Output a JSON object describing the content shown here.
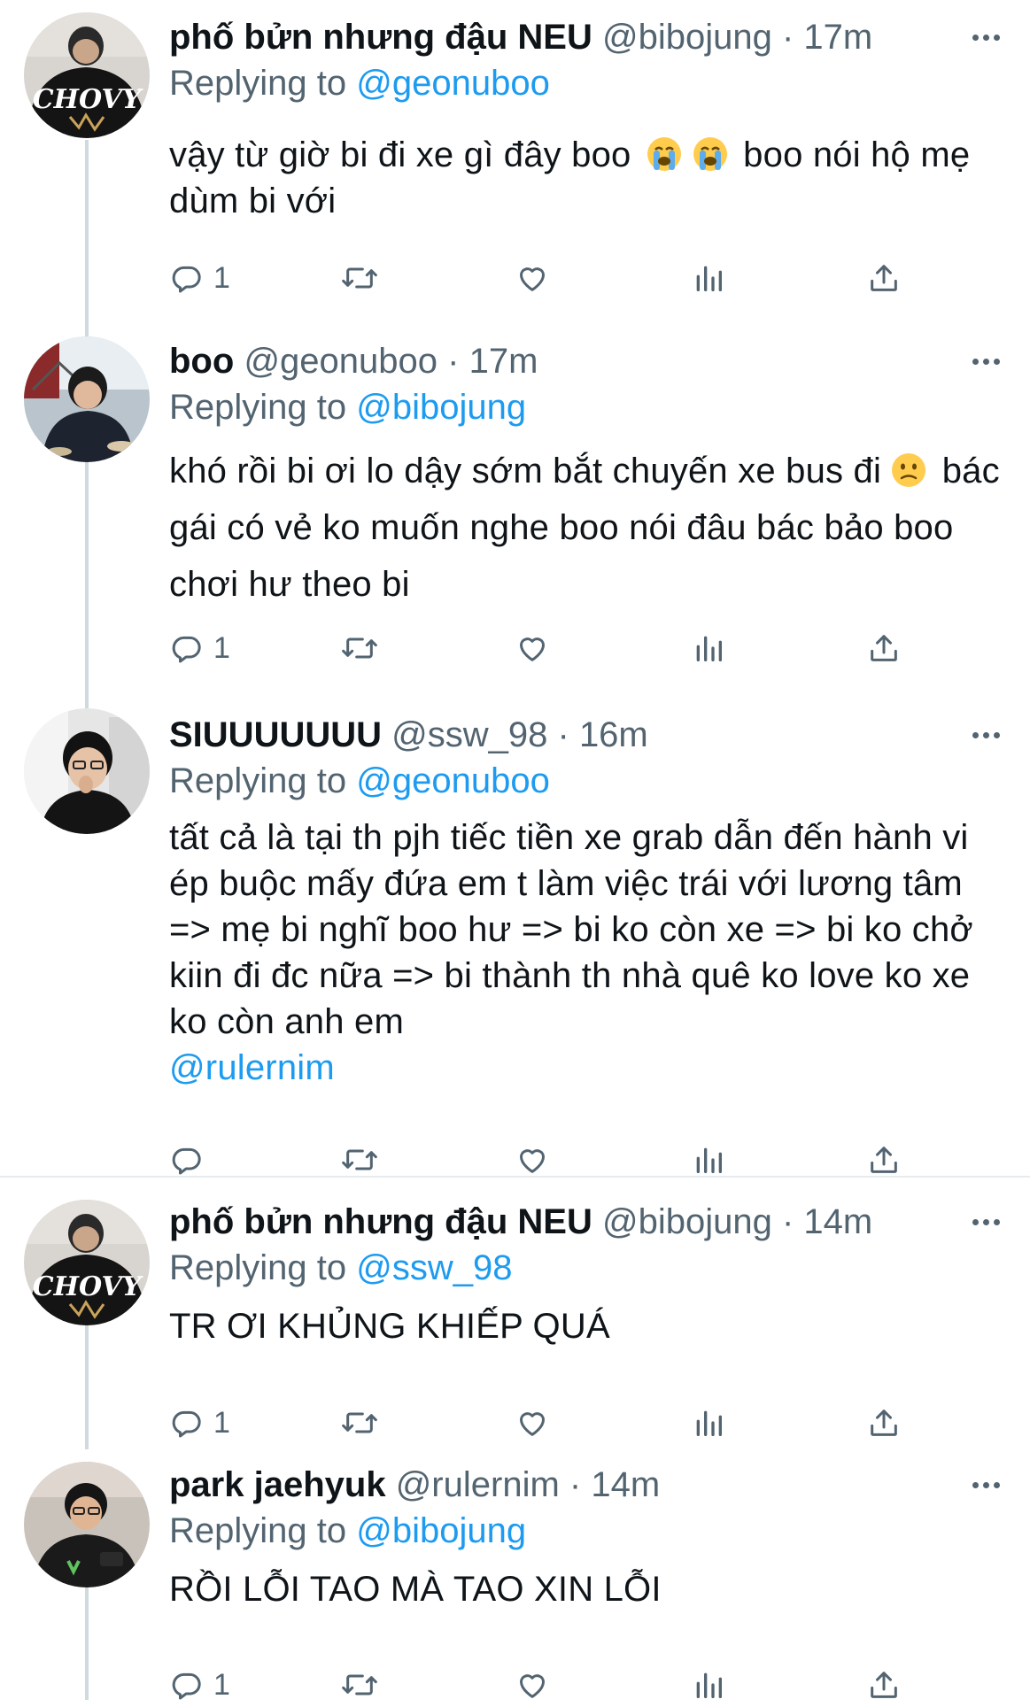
{
  "colors": {
    "accent": "#1d9bf0",
    "secondary_text": "#536471",
    "primary_text": "#0f1419",
    "thread_line": "#cfd9de"
  },
  "tweets": [
    {
      "name": "phố bửn nhưng đậu NEU",
      "handle": "@bibojung",
      "dot": "·",
      "time": "17m",
      "replying_label": "Replying to",
      "replying_to": "@geonuboo",
      "text_1": "vậy từ giờ bi đi xe gì đây boo",
      "emoji_1": "loudly-crying-face",
      "emoji_2": "loudly-crying-face",
      "text_2": "boo nói hộ mẹ dùm bi với",
      "reply_count": "1",
      "avatar_text": "CHOVY"
    },
    {
      "name": "boo",
      "handle": "@geonuboo",
      "dot": "·",
      "time": "17m",
      "replying_label": "Replying to",
      "replying_to": "@bibojung",
      "text_1": "khó rồi bi ơi lo dậy sớm bắt chuyến xe bus đi",
      "emoji_1": "confused-face",
      "text_2": "bác gái có vẻ ko muốn nghe boo nói đâu bác bảo boo chơi hư theo bi",
      "reply_count": "1"
    },
    {
      "name": "SIUUUUUUU",
      "handle": "@ssw_98",
      "dot": "·",
      "time": "16m",
      "replying_label": "Replying to",
      "replying_to": "@geonuboo",
      "text_1": "tất cả là tại th pjh tiếc tiền xe grab dẫn đến hành vi ép buộc mấy đứa em t làm việc trái với lương tâm => mẹ bi nghĩ boo hư => bi ko còn xe => bi ko chở kiin đi đc nữa => bi thành th nhà quê ko love ko xe ko còn anh em",
      "mention_in_text": "@rulernim",
      "reply_count": ""
    },
    {
      "name": "phố bửn nhưng đậu NEU",
      "handle": "@bibojung",
      "dot": "·",
      "time": "14m",
      "replying_label": "Replying to",
      "replying_to": "@ssw_98",
      "text_1": "TR ƠI KHỦNG KHIẾP QUÁ",
      "reply_count": "1",
      "avatar_text": "CHOVY"
    },
    {
      "name": "park jaehyuk",
      "handle": "@rulernim",
      "dot": "·",
      "time": "14m",
      "replying_label": "Replying to",
      "replying_to": "@bibojung",
      "text_1": "RỒI LỖI TAO MÀ TAO XIN LỖI",
      "reply_count": "1"
    }
  ],
  "icons": {
    "reply": "reply-icon",
    "retweet": "retweet-icon",
    "like": "like-icon",
    "views": "views-icon",
    "share": "share-icon",
    "more": "more-icon"
  }
}
